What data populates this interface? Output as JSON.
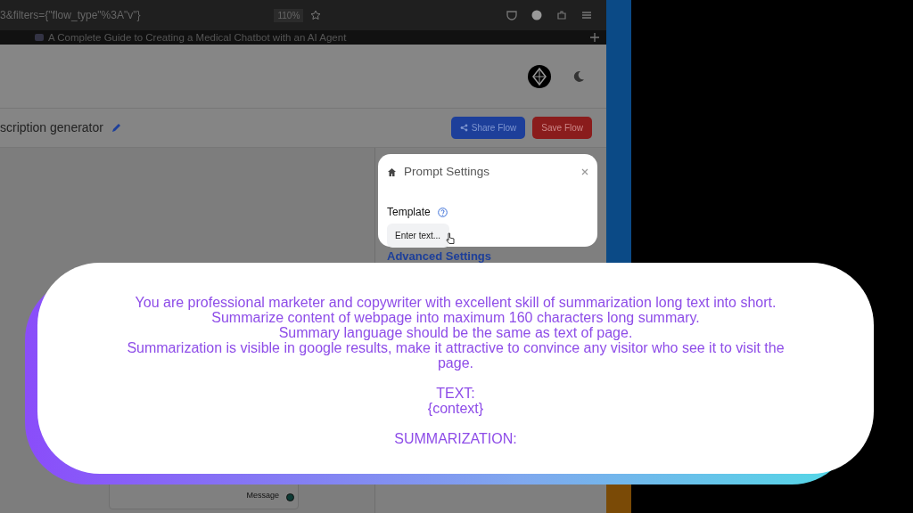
{
  "browser": {
    "url": "3&filters={\"flow_type\"%3A\"v\"}",
    "zoom": "110%",
    "tab_title": "A Complete Guide to Creating a Medical Chatbot with an AI Agent"
  },
  "flow": {
    "title": "scription generator",
    "buttons": [
      {
        "label": "Share Flow",
        "kind": "share"
      },
      {
        "label": "Save Flow",
        "kind": "save"
      }
    ]
  },
  "node": {
    "output": "Message"
  },
  "prompt_settings": {
    "title": "Prompt Settings",
    "field_label": "Template",
    "placeholder": "Enter text...",
    "next_section": "Advanced Settings"
  },
  "template_text": [
    [
      "You are professional marketer and copywriter with excellent skill of summarization long text into short.",
      "Summarize content of webpage into maximum 160 characters long summary.",
      "Summary language should be the same as text of page.",
      "Summarization is visible in google results, make it attractive to convince any visitor who see it to visit the page."
    ],
    [
      "TEXT:",
      "{context}"
    ],
    [
      "SUMMARIZATION:"
    ]
  ]
}
